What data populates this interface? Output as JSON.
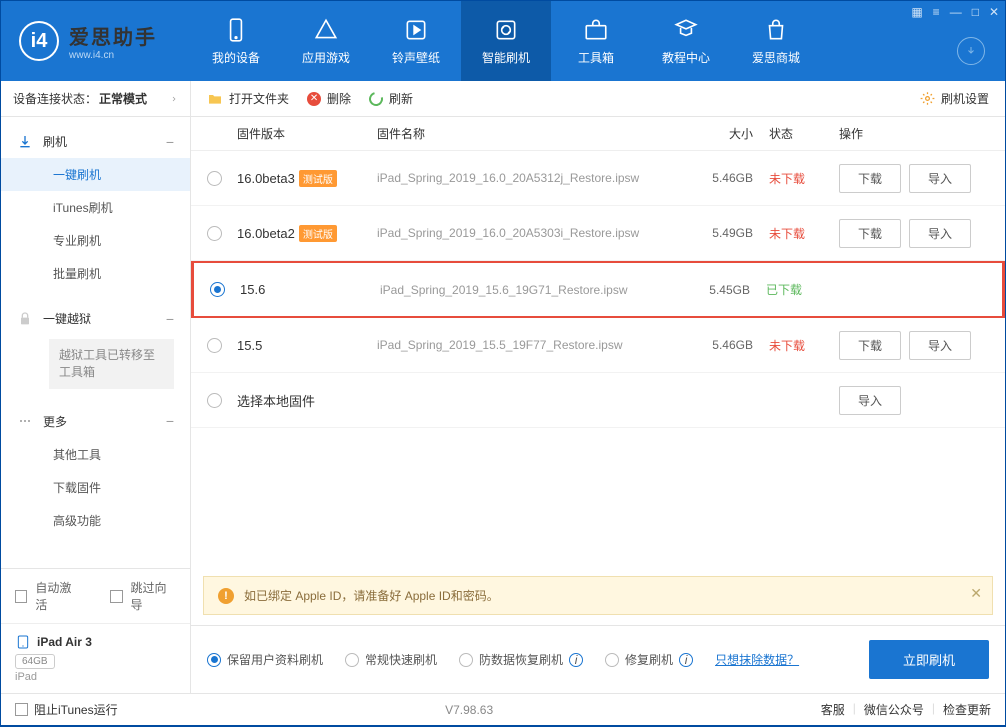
{
  "app": {
    "title": "爱思助手",
    "subtitle": "www.i4.cn"
  },
  "nav": {
    "items": [
      {
        "label": "我的设备"
      },
      {
        "label": "应用游戏"
      },
      {
        "label": "铃声壁纸"
      },
      {
        "label": "智能刷机"
      },
      {
        "label": "工具箱"
      },
      {
        "label": "教程中心"
      },
      {
        "label": "爱思商城"
      }
    ]
  },
  "sidebar": {
    "status_label": "设备连接状态：",
    "status_value": "正常模式",
    "flash_label": "刷机",
    "subs": [
      {
        "label": "一键刷机"
      },
      {
        "label": "iTunes刷机"
      },
      {
        "label": "专业刷机"
      },
      {
        "label": "批量刷机"
      }
    ],
    "jailbreak_label": "一键越狱",
    "jb_note": "越狱工具已转移至工具箱",
    "more_label": "更多",
    "more_subs": [
      {
        "label": "其他工具"
      },
      {
        "label": "下载固件"
      },
      {
        "label": "高级功能"
      }
    ],
    "auto_activate": "自动激活",
    "skip_guide": "跳过向导",
    "device_name": "iPad Air 3",
    "storage": "64GB",
    "device_type": "iPad"
  },
  "toolbar": {
    "open_folder": "打开文件夹",
    "delete": "删除",
    "refresh": "刷新",
    "settings": "刷机设置"
  },
  "table": {
    "headers": {
      "version": "固件版本",
      "name": "固件名称",
      "size": "大小",
      "status": "状态",
      "ops": "操作"
    },
    "beta_tag": "测试版",
    "btn_download": "下载",
    "btn_import": "导入",
    "rows": [
      {
        "version": "16.0beta3",
        "beta": true,
        "name": "iPad_Spring_2019_16.0_20A5312j_Restore.ipsw",
        "size": "5.46GB",
        "status": "未下载",
        "downloaded": false,
        "selected": false,
        "ops": true
      },
      {
        "version": "16.0beta2",
        "beta": true,
        "name": "iPad_Spring_2019_16.0_20A5303i_Restore.ipsw",
        "size": "5.49GB",
        "status": "未下载",
        "downloaded": false,
        "selected": false,
        "ops": true
      },
      {
        "version": "15.6",
        "beta": false,
        "name": "iPad_Spring_2019_15.6_19G71_Restore.ipsw",
        "size": "5.45GB",
        "status": "已下载",
        "downloaded": true,
        "selected": true,
        "ops": false
      },
      {
        "version": "15.5",
        "beta": false,
        "name": "iPad_Spring_2019_15.5_19F77_Restore.ipsw",
        "size": "5.46GB",
        "status": "未下载",
        "downloaded": false,
        "selected": false,
        "ops": true
      }
    ],
    "local_row": "选择本地固件"
  },
  "warning": "如已绑定 Apple ID，请准备好 Apple ID和密码。",
  "options": {
    "opt1": "保留用户资料刷机",
    "opt2": "常规快速刷机",
    "opt3": "防数据恢复刷机",
    "opt4": "修复刷机",
    "link": "只想抹除数据？",
    "primary": "立即刷机"
  },
  "footer": {
    "block_itunes": "阻止iTunes运行",
    "version": "V7.98.63",
    "links": [
      "客服",
      "微信公众号",
      "检查更新"
    ]
  }
}
